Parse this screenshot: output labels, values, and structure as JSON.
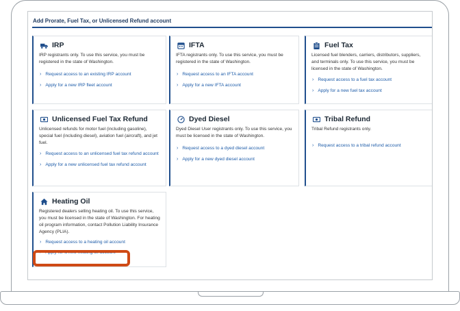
{
  "panel": {
    "title": "Add Prorate, Fuel Tax, or Unlicensed Refund account"
  },
  "cards": [
    {
      "title": "IRP",
      "icon": "truck-icon",
      "desc": "IRP registrants only. To use this service, you must be registered in the state of Washington.",
      "links": [
        "Request access to an existing IRP account",
        "Apply for a new IRP fleet account"
      ]
    },
    {
      "title": "IFTA",
      "icon": "calendar-icon",
      "desc": "IFTA registrants only. To use this service, you must be registered in the state of Washington.",
      "links": [
        "Request access to an IFTA account",
        "Apply for a new IFTA account"
      ]
    },
    {
      "title": "Fuel Tax",
      "icon": "clipboard-icon",
      "desc": "Licensed fuel blenders, carriers, distributors, suppliers, and terminals only. To use this service, you must be licensed in the state of Washington.",
      "links": [
        "Request access to a fuel tax account",
        "Apply for a new fuel tax account"
      ]
    },
    {
      "title": "Unlicensed Fuel Tax Refund",
      "icon": "money-icon",
      "desc": "Unlicensed refunds for motor fuel (including gasoline), special fuel (including diesel), aviation fuel (aircraft), and jet fuel.",
      "links": [
        "Request access to an unlicensed fuel tax refund account",
        "Apply for a new unlicensed fuel tax refund account"
      ]
    },
    {
      "title": "Dyed Diesel",
      "icon": "gauge-icon",
      "desc": "Dyed Diesel User registrants only. To use this service, you must be licensed in the state of Washington.",
      "links": [
        "Request access to a dyed diesel account",
        "Apply for a new dyed diesel account"
      ]
    },
    {
      "title": "Tribal Refund",
      "icon": "money-icon",
      "desc": "Tribal Refund registrants only.",
      "links": [
        "Request access to a tribal refund account"
      ]
    },
    {
      "title": "Heating Oil",
      "icon": "house-icon",
      "desc": "Registered dealers selling heating oil. To use this service, you must be licensed in the state of Washington. For heating oil program information, contact Pollution Liability Insurance Agency (PLIA).",
      "links": [
        "Request access to a heating oil account",
        "Apply for a new heating oil account"
      ]
    }
  ],
  "colors": {
    "accent": "#1f4e8c",
    "link": "#1c5ba8",
    "highlight": "#cf4a15"
  }
}
